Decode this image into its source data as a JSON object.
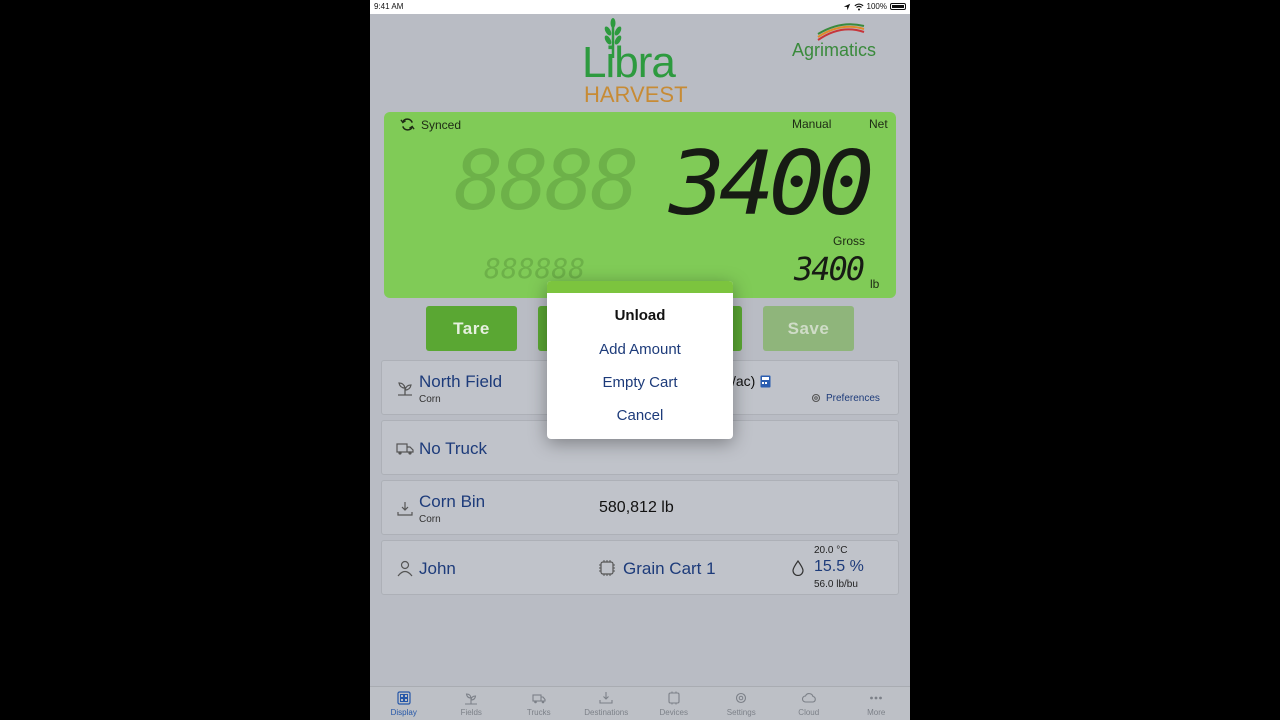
{
  "status_bar": {
    "time": "9:41 AM",
    "battery": "100%"
  },
  "logo": {
    "line1": "Libra",
    "line2": "HARVEST"
  },
  "brand": {
    "name": "Agrimatics"
  },
  "scale": {
    "sync_status": "Synced",
    "mode": "Manual",
    "net_label": "Net",
    "net_value": "3400",
    "gross_label": "Gross",
    "gross_value": "3400",
    "unit": "lb"
  },
  "buttons": {
    "tare": "Tare",
    "save": "Save"
  },
  "field": {
    "name": "North Field",
    "crop": "Corn",
    "rate_fragment": "/ac)",
    "preferences": "Preferences"
  },
  "truck": {
    "name": "No Truck"
  },
  "destination": {
    "name": "Corn Bin",
    "crop": "Corn",
    "amount": "580,812 lb"
  },
  "operator": {
    "name": "John",
    "device": "Grain Cart 1",
    "temperature": "20.0 °C",
    "moisture": "15.5 %",
    "test_weight": "56.0 lb/bu"
  },
  "dialog": {
    "title": "Unload",
    "options": [
      "Add Amount",
      "Empty Cart",
      "Cancel"
    ]
  },
  "tabs": [
    {
      "label": "Display",
      "icon": "display-icon",
      "active": true
    },
    {
      "label": "Fields",
      "icon": "fields-icon"
    },
    {
      "label": "Trucks",
      "icon": "truck-icon"
    },
    {
      "label": "Destinations",
      "icon": "destinations-icon"
    },
    {
      "label": "Devices",
      "icon": "devices-icon"
    },
    {
      "label": "Settings",
      "icon": "gear-icon"
    },
    {
      "label": "Cloud",
      "icon": "cloud-icon"
    },
    {
      "label": "More",
      "icon": "more-icon"
    }
  ],
  "colors": {
    "lcd": "#80cb57",
    "accent": "#5aa733",
    "link": "#1d3b7a",
    "dialog_bar": "#7cc43e"
  }
}
